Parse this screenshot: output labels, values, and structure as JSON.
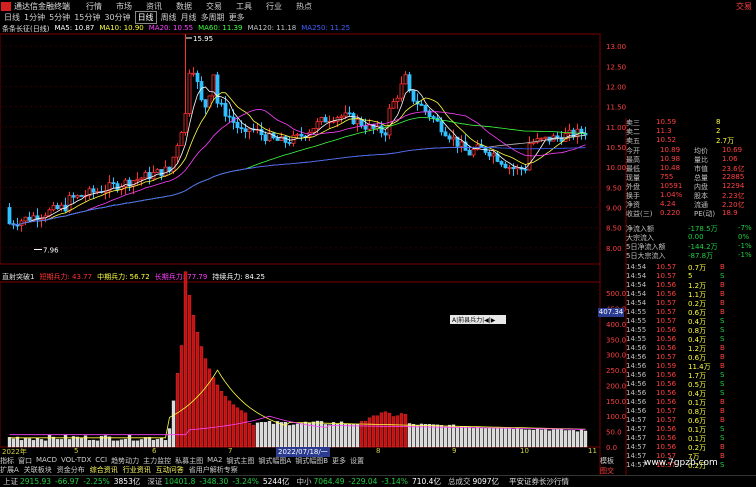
{
  "menubar": {
    "app": "通达信金融终端",
    "items": [
      "行情",
      "市场",
      "资讯",
      "数据",
      "交易",
      "工具",
      "行业",
      "热点"
    ],
    "right": "交易"
  },
  "periods": {
    "items": [
      "日线",
      "1分钟",
      "5分钟",
      "15分钟",
      "30分钟",
      "日线",
      "周线",
      "月线",
      "多周期",
      "更多"
    ],
    "active_index": 5
  },
  "main_legend": {
    "name": "条条长征(日线)",
    "ma": [
      {
        "label": "MA5: 10.87",
        "color": "#ffffff"
      },
      {
        "label": "MA10: 10.90",
        "color": "#ffff40"
      },
      {
        "label": "MA20: 10.55",
        "color": "#ff40ff"
      },
      {
        "label": "MA60: 11.39",
        "color": "#40ff40"
      },
      {
        "label": "MA120: 11.18",
        "color": "#c0c0c0"
      },
      {
        "label": "MA250: 11.25",
        "color": "#4060ff"
      }
    ]
  },
  "sub_legend": {
    "name": "直射突破1",
    "items": [
      {
        "label": "短期兵力: 43.77",
        "color": "#ff3030"
      },
      {
        "label": "中期兵力: 56.72",
        "color": "#ffff40"
      },
      {
        "label": "长期兵力: 77.79",
        "color": "#ff40ff"
      },
      {
        "label": "持续兵力: 84.25",
        "color": "#ffffff"
      }
    ]
  },
  "price_axis": [
    "13.00",
    "12.50",
    "12.00",
    "11.50",
    "11.00",
    "10.50",
    "10.00",
    "9.50",
    "9.00",
    "8.50",
    "8.00"
  ],
  "sub_axis": [
    "500.0",
    "450.0",
    "400.0",
    "350.0",
    "300.0",
    "250.0",
    "200.0",
    "150.0",
    "100.0",
    "50.0",
    "0.0"
  ],
  "annotations": {
    "high": "15.95",
    "low": "7.96",
    "price_tag": "407.34"
  },
  "xaxis": {
    "labels": [
      "2022年",
      "5",
      "6",
      "7",
      "8",
      "9",
      "10",
      "11"
    ],
    "selected": "2022/07/18/一"
  },
  "tabs1": {
    "items": [
      "指标",
      "窗口",
      "MACD",
      "VOL-TDX",
      "CCI",
      "趋势动力",
      "主力监控",
      "私募主图",
      "MA2",
      "钢式主图",
      "钢式幅图A",
      "钢式幅图B",
      "更多",
      "设置"
    ],
    "right": "模板"
  },
  "tabs2": {
    "items": [
      "扩展A",
      "关联板块",
      "资金分布",
      "综合资讯",
      "行业资讯",
      "互动问答",
      "省用户解析专察"
    ],
    "highlight": [
      3,
      4,
      5
    ]
  },
  "tabs_right2": "图交F10 ",
  "selectbox": "A|前县兵力|◀|▶",
  "quote": {
    "sell": [
      {
        "label": "卖三",
        "price": "10.59",
        "vol": "8"
      },
      {
        "label": "卖二",
        "price": "11.3",
        "vol": "2"
      },
      {
        "label": "卖五",
        "price": "10.52",
        "vol": "2.7万"
      }
    ],
    "stats": [
      {
        "l1": "今开",
        "v1": "10.89",
        "l2": "均价",
        "v2": "10.69"
      },
      {
        "l1": "最高",
        "v1": "10.98",
        "l2": "量比",
        "v2": "1.06"
      },
      {
        "l1": "最低",
        "v1": "10.48",
        "l2": "市值",
        "v2": "23.6亿"
      },
      {
        "l1": "现量",
        "v1": "755",
        "l2": "总量",
        "v2": "22885"
      },
      {
        "l1": "外盘",
        "v1": "10591",
        "l2": "内盘",
        "v2": "12294"
      },
      {
        "l1": "换手",
        "v1": "1.04%",
        "l2": "股本",
        "v2": "2.23亿"
      },
      {
        "l1": "净资",
        "v1": "4.24",
        "l2": "流通",
        "v2": "2.20亿"
      },
      {
        "l1": "收益(三)",
        "v1": "0.220",
        "l2": "PE(动)",
        "v2": "18.9"
      }
    ],
    "flows": [
      {
        "label": "净流入额",
        "value": "-178.5万",
        "pct": "-7%"
      },
      {
        "label": "大宗流入",
        "value": "0.00",
        "pct": "0%"
      },
      {
        "label": "5日净流入额",
        "value": "-144.2万",
        "pct": "-1%"
      },
      {
        "label": "5日大宗流入",
        "value": "-87.8万",
        "pct": "-1%"
      }
    ]
  },
  "ticks": [
    {
      "t": "14:54",
      "p": "10.57",
      "v": "0.7万",
      "d": "B"
    },
    {
      "t": "14:54",
      "p": "10.57",
      "v": "5",
      "d": "S"
    },
    {
      "t": "14:54",
      "p": "10.56",
      "v": "1.2万",
      "d": "B"
    },
    {
      "t": "14:54",
      "p": "10.56",
      "v": "1.1万",
      "d": "B"
    },
    {
      "t": "14:54",
      "p": "10.57",
      "v": "0.2万",
      "d": "B"
    },
    {
      "t": "14:55",
      "p": "10.57",
      "v": "0.6万",
      "d": "B"
    },
    {
      "t": "14:55",
      "p": "10.57",
      "v": "0.4万",
      "d": "S"
    },
    {
      "t": "14:55",
      "p": "10.56",
      "v": "0.8万",
      "d": "S"
    },
    {
      "t": "14:55",
      "p": "10.56",
      "v": "0.4万",
      "d": "S"
    },
    {
      "t": "14:56",
      "p": "10.56",
      "v": "1.2万",
      "d": "B"
    },
    {
      "t": "14:56",
      "p": "10.57",
      "v": "0.6万",
      "d": "B"
    },
    {
      "t": "14:56",
      "p": "10.59",
      "v": "11.4万",
      "d": "B"
    },
    {
      "t": "14:56",
      "p": "10.56",
      "v": "1.7万",
      "d": "S"
    },
    {
      "t": "14:56",
      "p": "10.56",
      "v": "0.5万",
      "d": "S"
    },
    {
      "t": "14:56",
      "p": "10.56",
      "v": "0.4万",
      "d": "S"
    },
    {
      "t": "14:56",
      "p": "10.56",
      "v": "0.1万",
      "d": "B"
    },
    {
      "t": "14:56",
      "p": "10.57",
      "v": "0.8万",
      "d": "B"
    },
    {
      "t": "14:57",
      "p": "10.57",
      "v": "0.6万",
      "d": "B"
    },
    {
      "t": "14:57",
      "p": "10.56",
      "v": "0.1万",
      "d": "S"
    },
    {
      "t": "14:57",
      "p": "10.56",
      "v": "0.1万",
      "d": "S"
    },
    {
      "t": "14:57",
      "p": "10.56",
      "v": "0.2万",
      "d": "B"
    },
    {
      "t": "14:57",
      "p": "10.57",
      "v": "7万",
      "d": "B"
    },
    {
      "t": "14:57",
      "p": "10.57",
      "v": "0.2万",
      "d": "S"
    }
  ],
  "statusbar": [
    {
      "name": "上证",
      "v": "2915.93",
      "c": "-66.97",
      "p": "-2.25%",
      "a": "3853亿"
    },
    {
      "name": "深证",
      "v": "10401.8",
      "c": "-348.30",
      "p": "-3.24%",
      "a": "5244亿"
    },
    {
      "name": "中小",
      "v": "7064.49",
      "c": "-229.04",
      "p": "-3.14%",
      "a": "710.4亿"
    }
  ],
  "status_right": {
    "label": "总成交",
    "value": "9097亿",
    "note": "平安证券长沙行情"
  },
  "watermark": "www.7gpzb.com",
  "chart_data": {
    "type": "candlestick",
    "price_ylim": [
      7.5,
      13.5
    ],
    "high": 15.95,
    "low": 7.96,
    "sub_ylim": [
      0,
      520
    ],
    "indicator_peak": 500
  }
}
